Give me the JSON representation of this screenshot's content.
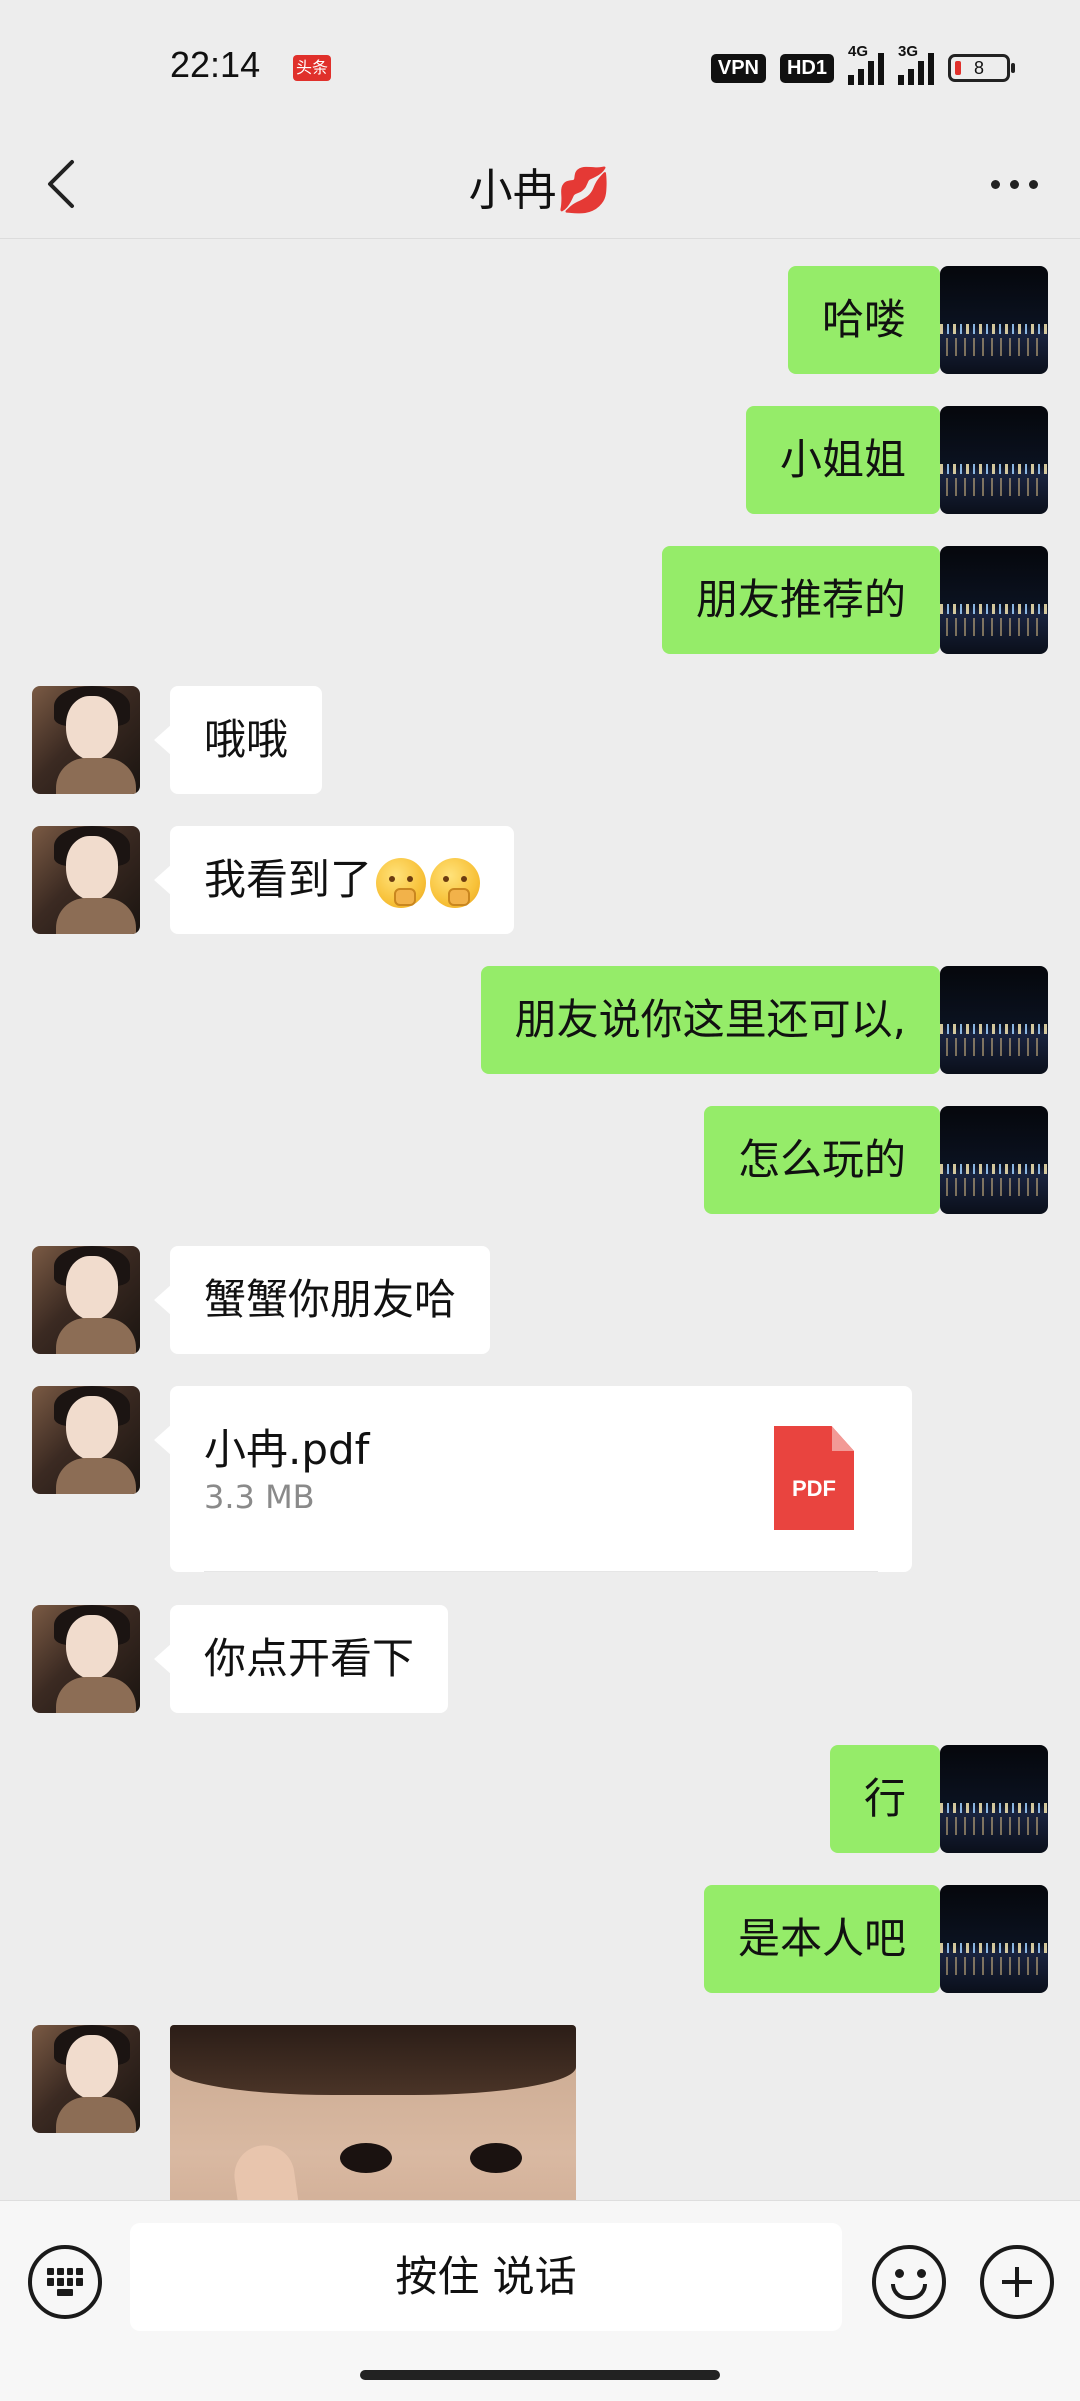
{
  "status_bar": {
    "time": "22:14",
    "news_badge": "头条",
    "vpn": "VPN",
    "hd": "HD1",
    "network1": "4G",
    "network2": "3G",
    "battery": "8"
  },
  "header": {
    "title": "小冉💋"
  },
  "messages": [
    {
      "side": "me",
      "type": "text",
      "text": "哈喽"
    },
    {
      "side": "me",
      "type": "text",
      "text": "小姐姐"
    },
    {
      "side": "me",
      "type": "text",
      "text": "朋友推荐的"
    },
    {
      "side": "her",
      "type": "text",
      "text": "哦哦"
    },
    {
      "side": "her",
      "type": "text",
      "text": "我看到了"
    },
    {
      "side": "me",
      "type": "text",
      "text": "朋友说你这里还可以,"
    },
    {
      "side": "me",
      "type": "text",
      "text": "怎么玩的"
    },
    {
      "side": "her",
      "type": "text",
      "text": "蟹蟹你朋友哈"
    },
    {
      "side": "her",
      "type": "file",
      "file_name": "小冉.pdf",
      "file_size": "3.3 MB",
      "file_type": "PDF"
    },
    {
      "side": "her",
      "type": "text",
      "text": "你点开看下"
    },
    {
      "side": "me",
      "type": "text",
      "text": "行"
    },
    {
      "side": "me",
      "type": "text",
      "text": "是本人吧"
    },
    {
      "side": "her",
      "type": "image"
    }
  ],
  "input_bar": {
    "voice_label": "按住 说话"
  },
  "icons": {
    "back": "chevron-left-icon",
    "more": "more-dots-icon",
    "keyboard": "keyboard-icon",
    "emoji": "emoji-smile-icon",
    "plus": "plus-circle-icon",
    "pdf": "pdf-file-icon"
  },
  "colors": {
    "background": "#ededed",
    "my_bubble": "#95ec69",
    "their_bubble": "#ffffff",
    "pdf_red": "#e9443f"
  }
}
